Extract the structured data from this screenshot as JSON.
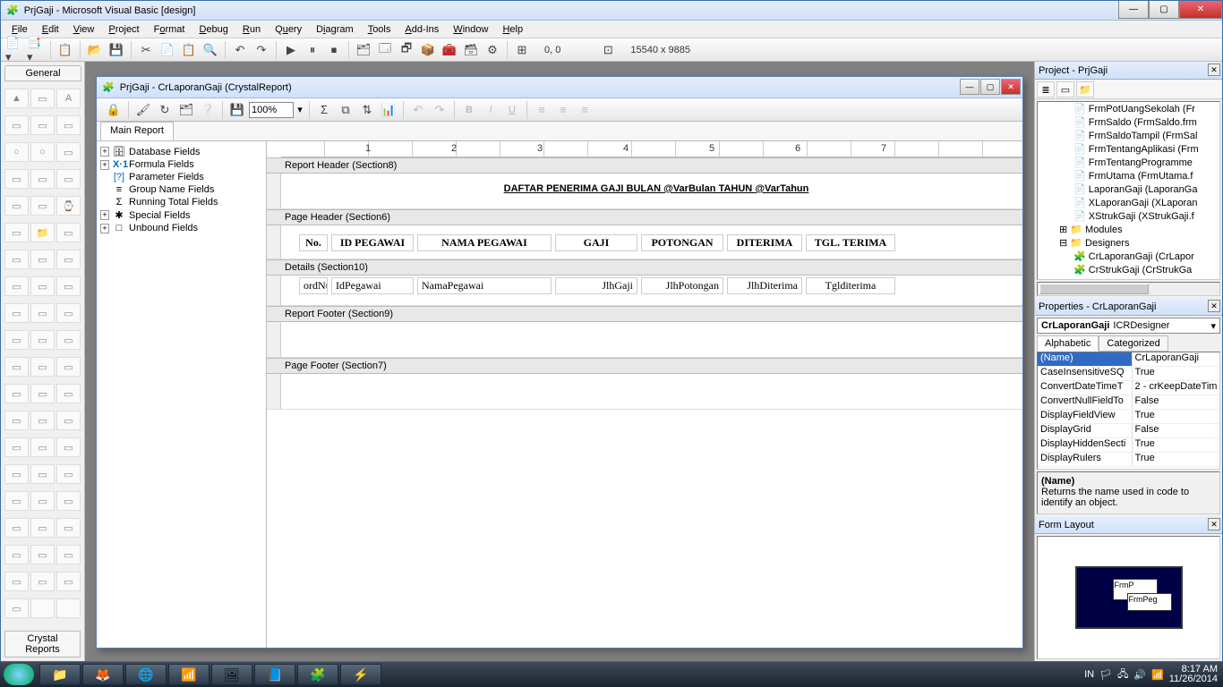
{
  "app": {
    "title": "PrjGaji - Microsoft Visual Basic [design]"
  },
  "menu": [
    "File",
    "Edit",
    "View",
    "Project",
    "Format",
    "Debug",
    "Run",
    "Query",
    "Diagram",
    "Tools",
    "Add-Ins",
    "Window",
    "Help"
  ],
  "coords": {
    "pos": "0, 0",
    "size": "15540 x 9885"
  },
  "left_tabs": {
    "general": "General",
    "crystal": "Crystal Reports"
  },
  "child": {
    "title": "PrjGaji - CrLaporanGaji (CrystalReport)",
    "zoom": "100%",
    "tab": "Main Report"
  },
  "field_tree": [
    {
      "exp": "+",
      "ico": "🗄",
      "label": "Database Fields"
    },
    {
      "exp": "+",
      "ico": "X·1",
      "label": "Formula Fields"
    },
    {
      "exp": "",
      "ico": "[?]",
      "label": "Parameter Fields"
    },
    {
      "exp": "",
      "ico": "≡",
      "label": "Group Name Fields"
    },
    {
      "exp": "",
      "ico": "Σ",
      "label": "Running Total Fields"
    },
    {
      "exp": "+",
      "ico": "✱",
      "label": "Special Fields"
    },
    {
      "exp": "+",
      "ico": "□",
      "label": "Unbound Fields"
    }
  ],
  "sections": {
    "report_header": "Report Header (Section8)",
    "page_header": "Page Header (Section6)",
    "details": "Details (Section10)",
    "report_footer": "Report Footer (Section9)",
    "page_footer": "Page Footer (Section7)"
  },
  "report_title": {
    "pre": "DAFTAR PENERIMA GAJI BULAN ",
    "v1": "@VarBulan",
    "mid": " TAHUN ",
    "v2": "@VarTahun"
  },
  "hdr_cols": [
    "No.",
    "ID PEGAWAI",
    "NAMA PEGAWAI",
    "GAJI",
    "POTONGAN",
    "DITERIMA",
    "TGL. TERIMA"
  ],
  "det_cols": [
    "ordNu",
    "IdPegawai",
    "NamaPegawai",
    "JlhGaji",
    "JlhPotongan",
    "JlhDiterima",
    "Tglditerima"
  ],
  "ruler_marks": [
    "1",
    "2",
    "3",
    "4",
    "5",
    "6",
    "7"
  ],
  "project": {
    "title": "Project - PrjGaji",
    "items": [
      "FrmPotUangSekolah (Fr",
      "FrmSaldo (FrmSaldo.frm",
      "FrmSaldoTampil (FrmSal",
      "FrmTentangAplikasi (Frm",
      "FrmTentangProgramme",
      "FrmUtama (FrmUtama.f",
      "LaporanGaji (LaporanGa",
      "XLaporanGaji (XLaporan",
      "XStrukGaji (XStrukGaji.f"
    ],
    "folders": [
      "Modules",
      "Designers"
    ],
    "designers": [
      "CrLaporanGaji (CrLapor",
      "CrStrukGaji (CrStrukGa"
    ]
  },
  "properties": {
    "title": "Properties - CrLaporanGaji",
    "object": "CrLaporanGaji ICRDesigner",
    "tabs": [
      "Alphabetic",
      "Categorized"
    ],
    "rows": [
      {
        "k": "(Name)",
        "v": "CrLaporanGaji",
        "sel": true
      },
      {
        "k": "CaseInsensitiveSQ",
        "v": "True"
      },
      {
        "k": "ConvertDateTimeT",
        "v": "2 - crKeepDateTim"
      },
      {
        "k": "ConvertNullFieldTo",
        "v": "False"
      },
      {
        "k": "DisplayFieldView",
        "v": "True"
      },
      {
        "k": "DisplayGrid",
        "v": "False"
      },
      {
        "k": "DisplayHiddenSecti",
        "v": "True"
      },
      {
        "k": "DisplayRulers",
        "v": "True"
      }
    ],
    "desc_name": "(Name)",
    "desc_text": "Returns the name used in code to identify an object."
  },
  "form_layout": {
    "title": "Form Layout",
    "w1": "FrmP",
    "w2": "FrmPeg"
  },
  "tray": {
    "lang": "IN",
    "time": "8:17 AM",
    "date": "11/26/2014"
  }
}
